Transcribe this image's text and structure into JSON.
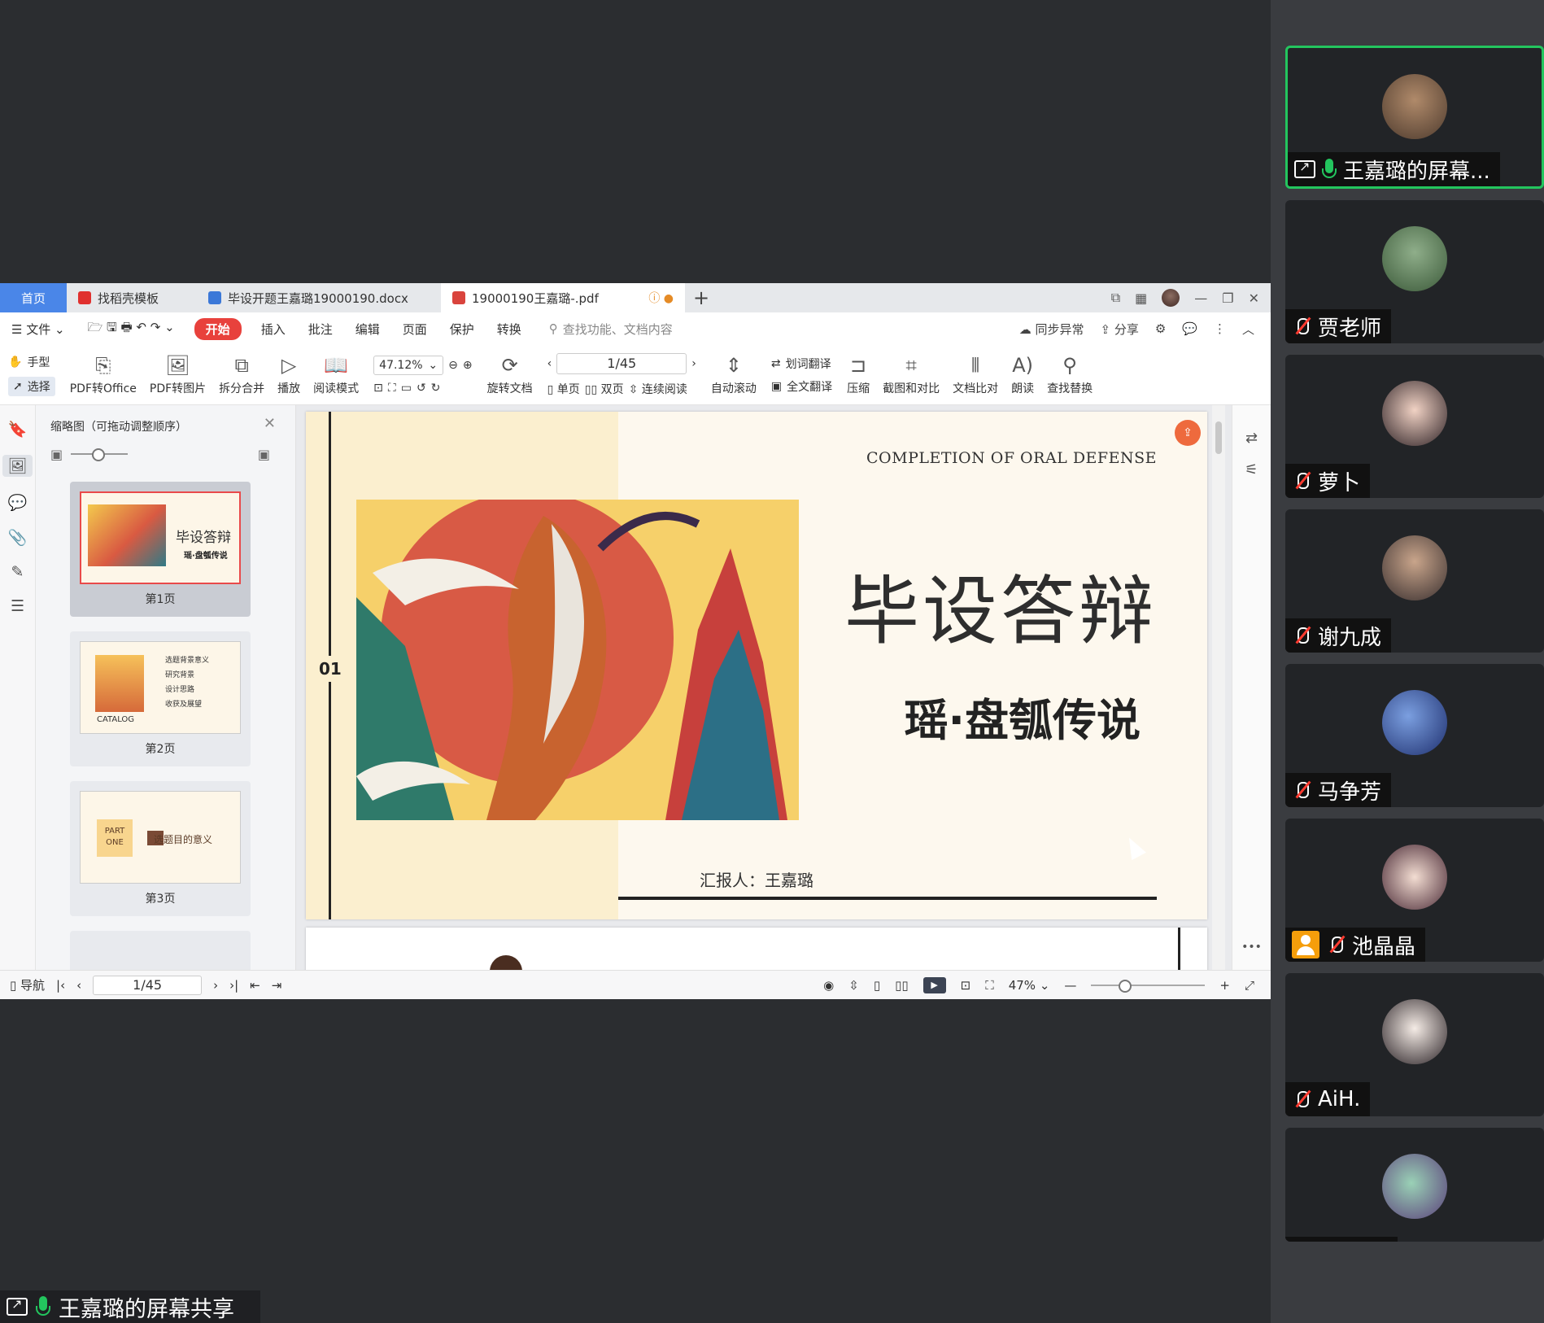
{
  "tabs": {
    "home": "首页",
    "t1": "找稻壳模板",
    "t2": "毕设开题王嘉璐19000190.docx",
    "t3": "19000190王嘉璐-.pdf",
    "add": "+"
  },
  "menu": {
    "file": "文件",
    "start": "开始",
    "items": [
      "插入",
      "批注",
      "编辑",
      "页面",
      "保护",
      "转换"
    ],
    "search": "查找功能、文档内容",
    "sync": "同步异常",
    "share": "分享"
  },
  "ribbon": {
    "hand": "手型",
    "select": "选择",
    "pdf_office": "PDF转Office",
    "pdf_image": "PDF转图片",
    "split_merge": "拆分合并",
    "play": "播放",
    "read_mode": "阅读模式",
    "zoom": "47.12%",
    "rotate": "旋转文档",
    "page_indicator": "1/45",
    "single": "单页",
    "double": "双页",
    "continuous": "连续阅读",
    "auto_scroll": "自动滚动",
    "word_translate": "划词翻译",
    "full_translate": "全文翻译",
    "compress": "压缩",
    "screenshot_compare": "截图和对比",
    "doc_compare": "文档比对",
    "read_aloud": "朗读",
    "find_replace": "查找替换"
  },
  "thumbs": {
    "header": "缩略图（可拖动调整顺序）",
    "pages": [
      {
        "label": "第1页",
        "title": "毕设答辩",
        "sub": "瑶·盘瓠传说"
      },
      {
        "label": "第2页",
        "cat": "CATALOG",
        "list": [
          "选题背景意义",
          "研究背景",
          "设计思路",
          "收获及展望"
        ]
      },
      {
        "label": "第3页",
        "part": "PART ONE",
        "sec": "选题目的意义",
        "num": "01"
      }
    ]
  },
  "doc": {
    "eng_title": "COMPLETION OF ORAL DEFENSE",
    "title": "毕设答辩",
    "subtitle": "瑶·盘瓠传说",
    "reporter": "汇报人：王嘉璐",
    "section_num": "01"
  },
  "status": {
    "nav": "导航",
    "page": "1/45",
    "zoom": "47%"
  },
  "share_label": "王嘉璐的屏幕共享",
  "participants": [
    {
      "name": "王嘉璐的屏幕...",
      "active": true
    },
    {
      "name": "贾老师"
    },
    {
      "name": "萝卜"
    },
    {
      "name": "谢九成"
    },
    {
      "name": "马争芳"
    },
    {
      "name": "池晶晶"
    },
    {
      "name": "AiH."
    },
    {
      "name": ""
    }
  ],
  "colors": {
    "tab_home": "#4a86e8",
    "start_btn": "#e8413c",
    "active_speaker": "#23c55e",
    "mic_off": "#ff3b30"
  }
}
